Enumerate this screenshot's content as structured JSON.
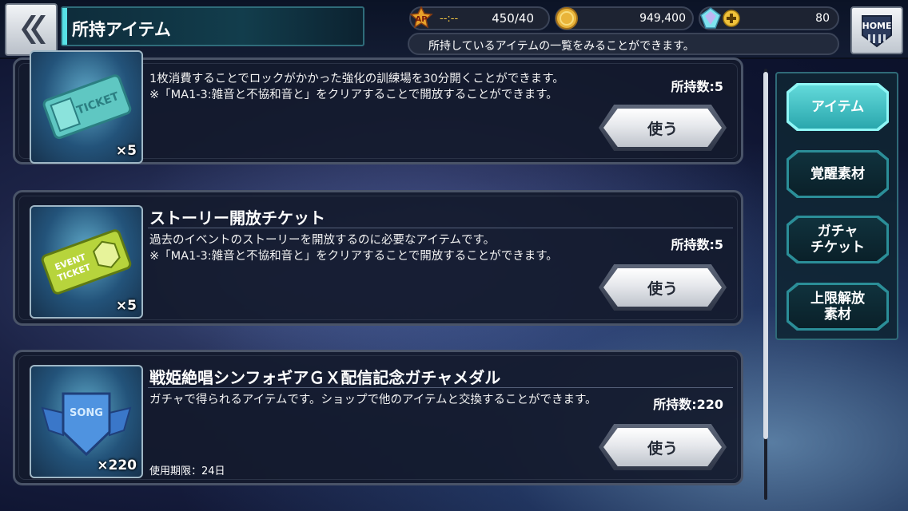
{
  "header": {
    "title": "所持アイテム",
    "ap_timer": "--:--",
    "ap_value": "450/40",
    "coins": "949,400",
    "gems": "80",
    "description": "所持しているアイテムの一覧をみることができます。",
    "home_label": "HOME"
  },
  "items": [
    {
      "name": "",
      "description": "1枚消費することでロックがかかった強化の訓練場を30分開くことができます。\n※「MA1-3:雑音と不協和音と」をクリアすることで開放することができます。",
      "owned": "所持数:5",
      "quantity": "×5",
      "use_label": "使う",
      "expiry": ""
    },
    {
      "name": "ストーリー開放チケット",
      "description": "過去のイベントのストーリーを開放するのに必要なアイテムです。\n※「MA1-3:雑音と不協和音と」をクリアすることで開放することができます。",
      "owned": "所持数:5",
      "quantity": "×5",
      "use_label": "使う",
      "expiry": ""
    },
    {
      "name": "戦姫絶唱シンフォギアＧＸ配信記念ガチャメダル",
      "description": "ガチャで得られるアイテムです。ショップで他のアイテムと交換することができます。",
      "owned": "所持数:220",
      "quantity": "×220",
      "use_label": "使う",
      "expiry": "使用期限：24日"
    }
  ],
  "tabs": [
    {
      "label": "アイテム",
      "active": true
    },
    {
      "label": "覚醒素材",
      "active": false
    },
    {
      "label": "ガチャ\nチケット",
      "active": false
    },
    {
      "label": "上限解放\n素材",
      "active": false
    }
  ],
  "colors": {
    "accent_cyan": "#57e0e6",
    "ap_timer": "#f2c642",
    "card_border": "#4a5468"
  }
}
